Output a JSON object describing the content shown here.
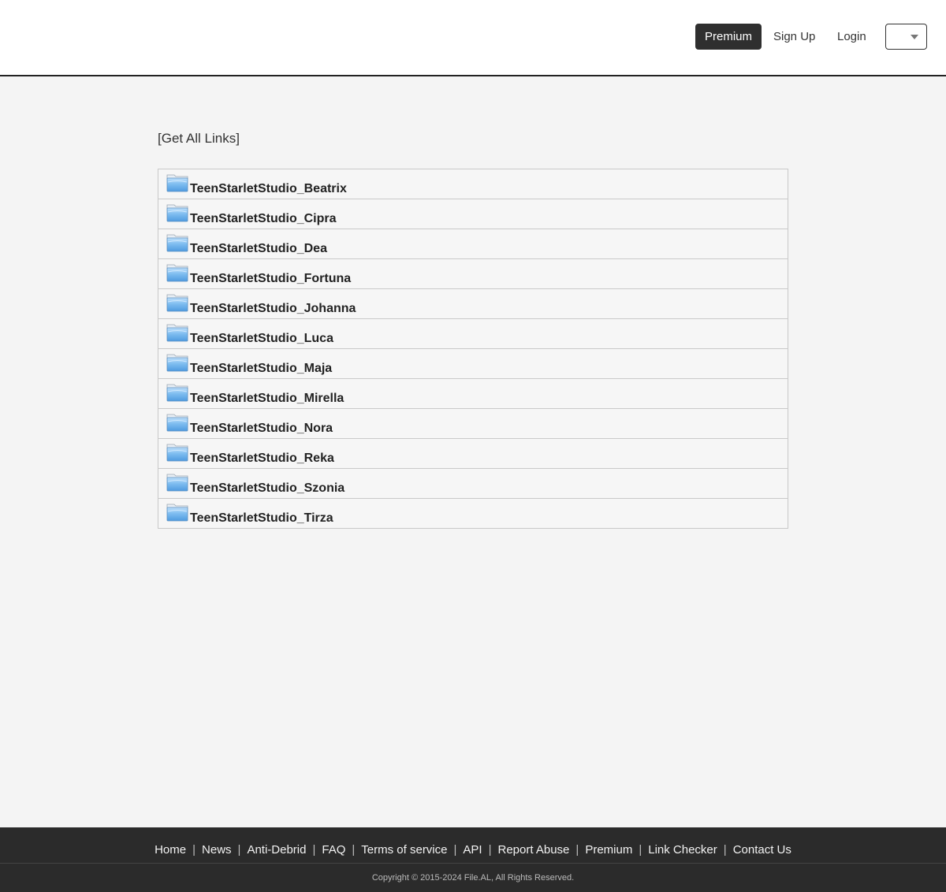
{
  "header": {
    "premium_label": "Premium",
    "signup_label": "Sign Up",
    "login_label": "Login",
    "language_value": ""
  },
  "main": {
    "get_all_links_label": "[Get All Links]",
    "folders": [
      "TeenStarletStudio_Beatrix",
      "TeenStarletStudio_Cipra",
      "TeenStarletStudio_Dea",
      "TeenStarletStudio_Fortuna",
      "TeenStarletStudio_Johanna",
      "TeenStarletStudio_Luca",
      "TeenStarletStudio_Maja",
      "TeenStarletStudio_Mirella",
      "TeenStarletStudio_Nora",
      "TeenStarletStudio_Reka",
      "TeenStarletStudio_Szonia",
      "TeenStarletStudio_Tirza"
    ]
  },
  "footer": {
    "links": [
      "Home",
      "News",
      "Anti-Debrid",
      "FAQ",
      "Terms of service",
      "API",
      "Report Abuse",
      "Premium",
      "Link Checker",
      "Contact Us"
    ],
    "separator": "|",
    "copyright": "Copyright © 2015-2024 File.AL, All Rights Reserved."
  },
  "colors": {
    "header_bg": "#ffffff",
    "page_bg": "#f4f4f4",
    "premium_btn_bg": "#2f2f2f",
    "footer_bg": "#2b2b2b",
    "folder_blue": "#6aaee8"
  },
  "icons": {
    "folder": "folder-icon",
    "dropdown": "caret-down-icon"
  }
}
